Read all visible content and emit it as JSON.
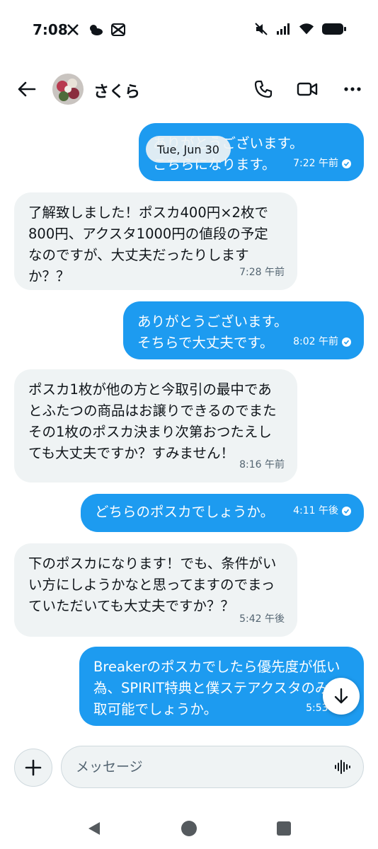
{
  "status_bar": {
    "time": "7:08"
  },
  "header": {
    "contact_name": "さくら"
  },
  "date_chip": "Tue, Jun 30",
  "messages": [
    {
      "direction": "out",
      "text": "ありがとうございます。\nこちらになります。",
      "time": "7:22 午前",
      "read": true
    },
    {
      "direction": "in",
      "text": "了解致しました！ポスカ400円×2枚で\n800円、アクスタ1000円の値段の予定\nなのですが、大丈夫だったりしますか？？",
      "time": "7:28 午前"
    },
    {
      "direction": "out",
      "text": "ありがとうございます。\nそちらで大丈夫です。",
      "time": "8:02 午前",
      "read": true
    },
    {
      "direction": "in",
      "text": "ポスカ1枚が他の方と今取引の最中であとふたつの商品はお譲りできるのでまたその1枚のポスカ決まり次第おつたえしても大丈夫ですか？すみません！",
      "time": "8:16 午前"
    },
    {
      "direction": "out",
      "text": "どちらのポスカでしょうか。",
      "time": "4:11 午後",
      "read": true
    },
    {
      "direction": "in",
      "text": "下のポスカになります！でも、条件がいい方にしようかなと思ってますのでまっていただいても大丈夫ですか？？",
      "time": "5:42 午後"
    },
    {
      "direction": "out",
      "text": "Breakerのポスカでしたら優先度が低い為、SPIRIT特典と僕ステアクスタのみ買取可能でしょうか。",
      "time": "5:53 午後"
    }
  ],
  "composer": {
    "placeholder": "メッセージ"
  },
  "colors": {
    "accent": "#1d9bf0",
    "incoming_bg": "#eff3f4",
    "text": "#0f1419",
    "muted": "#536471"
  }
}
